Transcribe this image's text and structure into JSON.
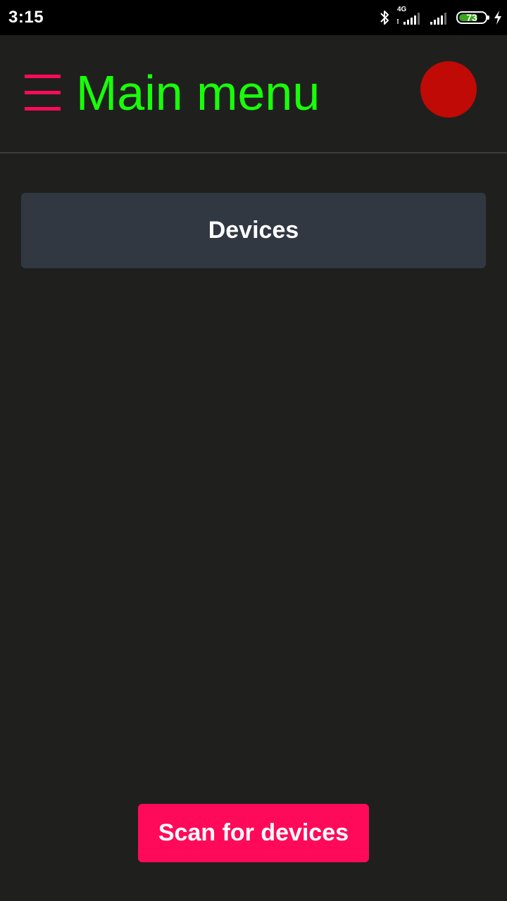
{
  "status_bar": {
    "time": "3:15",
    "network_type": "4G",
    "battery_level": "73",
    "battery_fraction": 0.73,
    "icons": [
      "bluetooth-icon",
      "signal-icon-sim1",
      "signal-icon-sim2",
      "battery-icon",
      "charging-bolt-icon"
    ]
  },
  "header": {
    "title": "Main menu",
    "menu_icon": "hamburger-menu-icon",
    "title_color": "#19ff0a",
    "menu_color": "#ff0a5a",
    "status_indicator_color": "#c00a06"
  },
  "main": {
    "devices_label": "Devices"
  },
  "footer": {
    "scan_label": "Scan for devices",
    "scan_color": "#ff0a5a"
  }
}
